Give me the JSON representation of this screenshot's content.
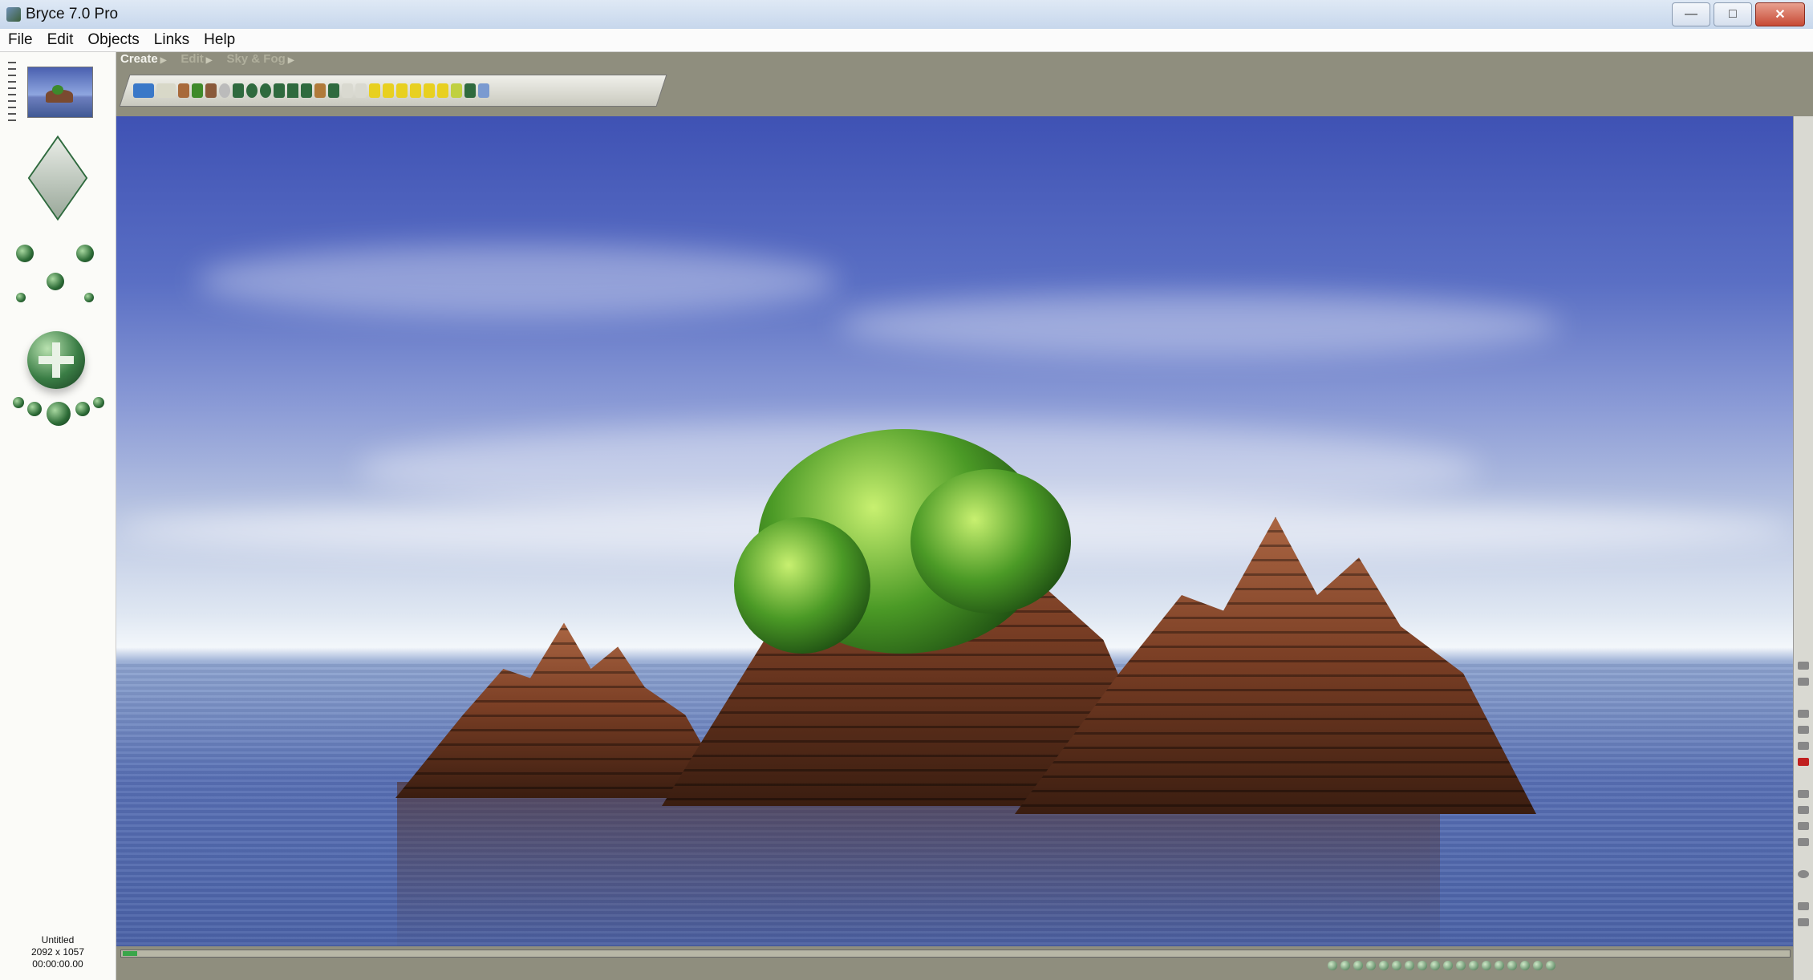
{
  "window": {
    "title": "Bryce 7.0 Pro",
    "controls": [
      "minimize",
      "maximize",
      "close"
    ],
    "control_glyphs": {
      "minimize": "—",
      "maximize": "□",
      "close": "✕"
    }
  },
  "menu": [
    "File",
    "Edit",
    "Objects",
    "Links",
    "Help"
  ],
  "palette_tabs": [
    {
      "label": "Create",
      "active": true
    },
    {
      "label": "Edit",
      "active": false
    },
    {
      "label": "Sky & Fog",
      "active": false
    }
  ],
  "document": {
    "name": "Untitled",
    "dimensions": "2092 x 1057",
    "time": "00:00:00.00"
  },
  "icons": {
    "left": [
      "nano-preview",
      "view-cube",
      "camera-dpad",
      "trackball"
    ],
    "toolbar": [
      "water-plane",
      "infinite-plane",
      "terrain",
      "tree",
      "rock",
      "torus",
      "sphere",
      "cube",
      "pyramid",
      "figure",
      "primitives",
      "lights"
    ]
  },
  "colors": {
    "panel": "#8f8e7e",
    "accent_green": "#2f6a3e",
    "sky_top": "#3f52b4",
    "sea": "#4c63a7"
  }
}
